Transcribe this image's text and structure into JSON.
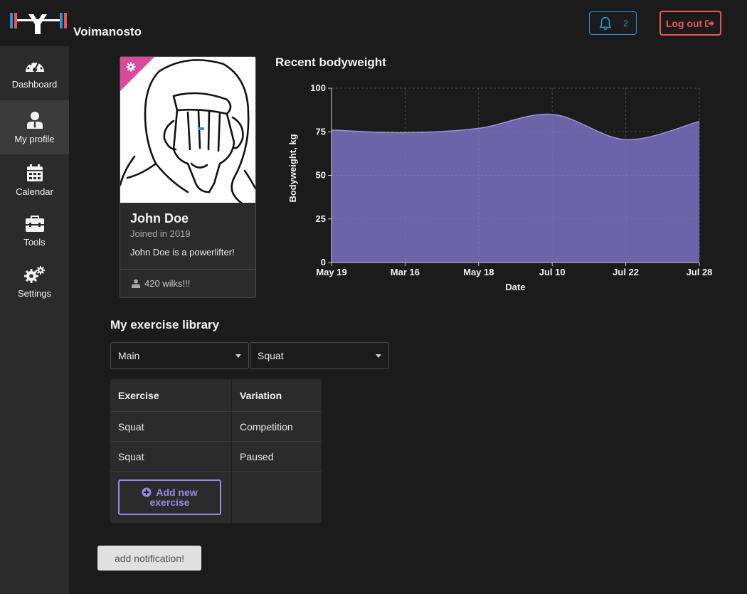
{
  "header": {
    "app_title": "Voimanosto",
    "notification_count": "2",
    "logout_label": "Log out",
    "accent_blue": "#2f8fd8",
    "accent_red": "#e8574f"
  },
  "sidebar": {
    "items": [
      {
        "label": "Dashboard",
        "icon": "dashboard-gauge-icon",
        "active": false
      },
      {
        "label": "My profile",
        "icon": "user-icon",
        "active": true
      },
      {
        "label": "Calendar",
        "icon": "calendar-icon",
        "active": false
      },
      {
        "label": "Tools",
        "icon": "toolbox-icon",
        "active": false
      },
      {
        "label": "Settings",
        "icon": "gears-icon",
        "active": false
      }
    ]
  },
  "profile": {
    "name": "John Doe",
    "joined": "Joined in 2019",
    "bio": "John Doe is a powerlifter!",
    "wilks": "420 wilks!!!",
    "badge_color": "#d94a9d"
  },
  "chart": {
    "title": "Recent bodyweight"
  },
  "chart_data": {
    "type": "area",
    "title": "Recent bodyweight",
    "xlabel": "Date",
    "ylabel": "Bodyweight, kg",
    "x": [
      "May 19",
      "Mar 16",
      "May 18",
      "Jul 10",
      "Jul 22",
      "Jul 28"
    ],
    "values": [
      76,
      74.5,
      77,
      85,
      70.5,
      81
    ],
    "ylim": [
      0,
      100
    ],
    "yticks": [
      0,
      25,
      50,
      75,
      100
    ],
    "grid": true,
    "fill_color": "#6c63a8",
    "line_color": "#9d95d8"
  },
  "library": {
    "title": "My exercise library",
    "filter_category": "Main",
    "filter_exercise": "Squat",
    "columns": [
      "Exercise",
      "Variation"
    ],
    "rows": [
      [
        "Squat",
        "Competition"
      ],
      [
        "Squat",
        "Paused"
      ]
    ],
    "add_label_1": "Add new",
    "add_label_2": "exercise",
    "add_color": "#9d87e8"
  },
  "footer": {
    "notify_label": "add notification!"
  }
}
